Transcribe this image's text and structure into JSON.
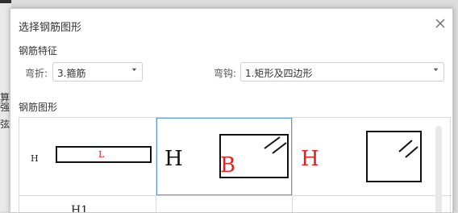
{
  "background": {
    "fragments": [
      "算",
      "弦",
      "强"
    ]
  },
  "dialog": {
    "title": "选择钢筋图形",
    "section_features": "钢筋特征",
    "bend_label": "弯折:",
    "bend_value": "3.箍筋",
    "hook_label": "弯钩:",
    "hook_value": "1.矩形及四边形",
    "section_shapes": "钢筋图形",
    "shapes": [
      {
        "label_h": "H",
        "label_l": "L"
      },
      {
        "label_h": "H",
        "label_b": "B"
      },
      {
        "label_h": "H"
      },
      {
        "label_h1": "H1"
      }
    ]
  },
  "colors": {
    "accent": "#5b9bd5",
    "red": "#e52222"
  }
}
